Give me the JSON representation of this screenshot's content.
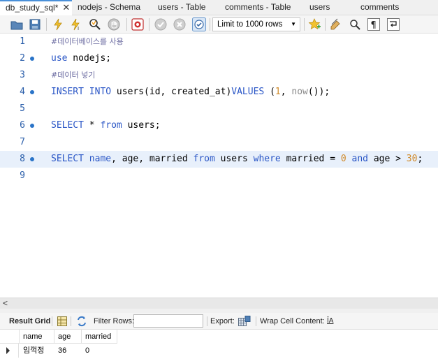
{
  "tabs": [
    {
      "label": "db_study_sql*",
      "close": "✕"
    },
    {
      "label": "nodejs - Schema"
    },
    {
      "label": "users - Table"
    },
    {
      "label": "comments - Table"
    },
    {
      "label": "users"
    },
    {
      "label": "comments"
    }
  ],
  "toolbar": {
    "limit_label": "Limit to 1000 rows",
    "icons": [
      "open-folder-icon",
      "save-icon",
      "execute-icon",
      "execute-current-icon",
      "explain-icon",
      "stop-icon",
      "toggle-continue-icon",
      "commit-icon",
      "rollback-icon",
      "autocommit-icon",
      "beautify-icon",
      "find-icon",
      "invisible-chars-icon",
      "wrap-icon",
      "favorite-icon"
    ]
  },
  "editor": {
    "lines": [
      {
        "n": "1"
      },
      {
        "n": "2"
      },
      {
        "n": "3"
      },
      {
        "n": "4"
      },
      {
        "n": "5"
      },
      {
        "n": "6"
      },
      {
        "n": "7"
      },
      {
        "n": "8"
      },
      {
        "n": "9"
      }
    ],
    "code": {
      "l1_comment": "#데이터베이스를 사용",
      "l2_kw": "use",
      "l2_rest": " nodejs;",
      "l3_comment": "#데이터 넣기",
      "l4_kw1": "INSERT INTO",
      "l4_rest1": " users(id, created_at)",
      "l4_kw2": "VALUES",
      "l4_rest2": " (",
      "l4_num": "1",
      "l4_rest3": ", ",
      "l4_fn": "now",
      "l4_rest4": "());",
      "l6_kw": "SELECT",
      "l6_rest1": " * ",
      "l6_kw2": "from",
      "l6_rest2": " users;",
      "l8_kw1": "SELECT",
      "l8_kw_name": "name",
      "l8_rest1": ", age, married ",
      "l8_kw2": "from",
      "l8_rest2": " users ",
      "l8_kw3": "where",
      "l8_rest3": " married = ",
      "l8_num1": "0",
      "l8_kw4": "and",
      "l8_rest4": " age > ",
      "l8_num2": "30",
      "l8_rest5": ";"
    }
  },
  "scroll": {
    "left_arrow": "<"
  },
  "result_toolbar": {
    "result_grid_label": "Result Grid",
    "filter_rows_label": "Filter Rows:",
    "filter_value": "",
    "export_label": "Export:",
    "wrap_label": "Wrap Cell Content:",
    "wrap_icon_text": "ĪA"
  },
  "grid": {
    "columns": [
      "name",
      "age",
      "married"
    ],
    "rows": [
      {
        "name": "임꺽정",
        "age": "36",
        "married": "0"
      }
    ]
  },
  "colors": {
    "keyword": "#2a56c6",
    "number": "#d08a2a",
    "function": "#8a8a8a",
    "comment": "#6a6aa0",
    "line_number": "#2a5eaa",
    "current_line": "#e8f0fb"
  }
}
